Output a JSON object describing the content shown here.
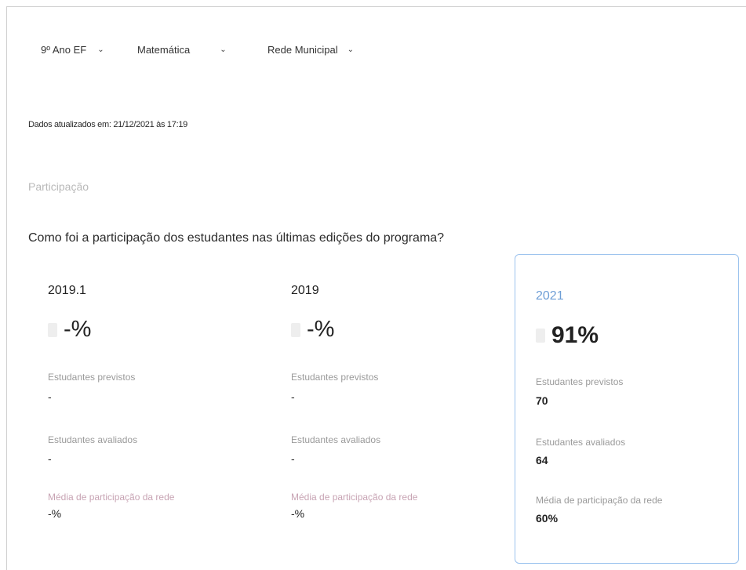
{
  "filters": {
    "grade": "9º Ano EF",
    "subject": "Matemática",
    "network": "Rede Municipal"
  },
  "updated_text": "Dados atualizados em: 21/12/2021 às 17:19",
  "section_label": "Participação",
  "question": "Como foi a participação dos estudantes nas últimas edições do programa?",
  "cards": [
    {
      "year": "2019.1",
      "percent": "-%",
      "expected_label": "Estudantes previstos",
      "expected_value": "-",
      "evaluated_label": "Estudantes avaliados",
      "evaluated_value": "-",
      "network_label": "Média de participação da rede",
      "network_value": "-%"
    },
    {
      "year": "2019",
      "percent": "-%",
      "expected_label": "Estudantes previstos",
      "expected_value": "-",
      "evaluated_label": "Estudantes avaliados",
      "evaluated_value": "-",
      "network_label": "Média de participação da rede",
      "network_value": "-%"
    },
    {
      "year": "2021",
      "percent": "91%",
      "expected_label": "Estudantes previstos",
      "expected_value": "70",
      "evaluated_label": "Estudantes avaliados",
      "evaluated_value": "64",
      "network_label": "Média de participação da rede",
      "network_value": "60%"
    }
  ],
  "colors": {
    "selected_border": "#9cc3ee",
    "selected_year": "#6e9ed6",
    "muted_label": "#9a9a9a",
    "network_label_pink": "#c7a3b3"
  }
}
